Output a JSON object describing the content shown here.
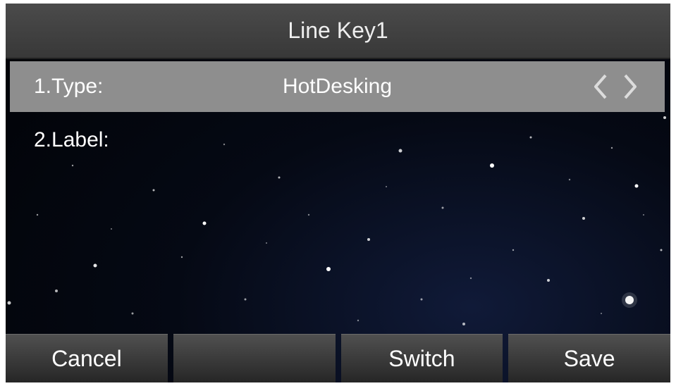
{
  "header": {
    "title": "Line Key1"
  },
  "fields": [
    {
      "label": "1.Type:",
      "value": "HotDesking"
    },
    {
      "label": "2.Label:",
      "value": ""
    }
  ],
  "icons": {
    "prev": "chevron-left-icon",
    "next": "chevron-right-icon"
  },
  "softkeys": [
    "Cancel",
    "",
    "Switch",
    "Save"
  ],
  "colors": {
    "selected_row": "#8e8e8e",
    "header": "#3f3f3f",
    "text": "#ffffff"
  }
}
